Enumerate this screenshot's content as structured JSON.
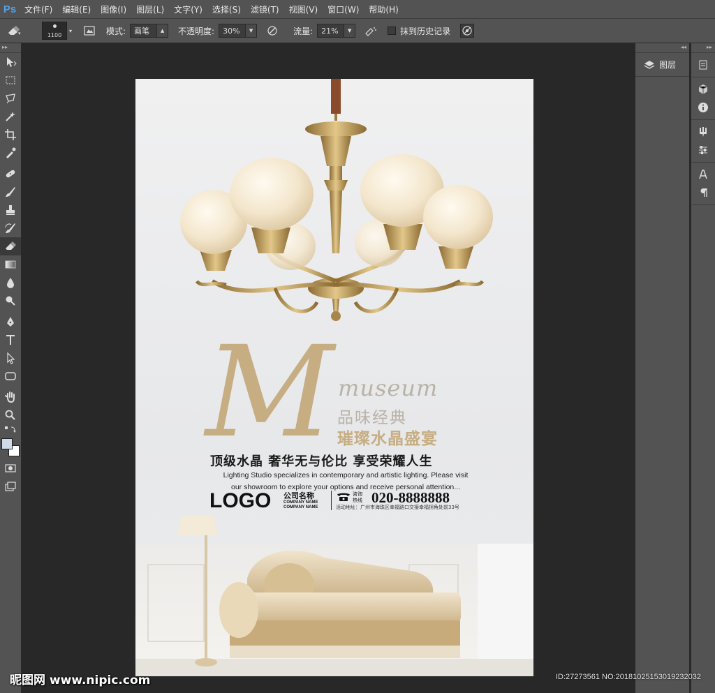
{
  "menubar": {
    "app_logo": "Ps",
    "items": [
      "文件(F)",
      "编辑(E)",
      "图像(I)",
      "图层(L)",
      "文字(Y)",
      "选择(S)",
      "滤镜(T)",
      "视图(V)",
      "窗口(W)",
      "帮助(H)"
    ]
  },
  "options": {
    "tool_icon": "eraser-icon",
    "brush_size": "1100",
    "mode_label": "模式:",
    "mode_value": "画笔",
    "opacity_label": "不透明度:",
    "opacity_value": "30%",
    "flow_label": "流量:",
    "flow_value": "21%",
    "erase_history_label": "抹到历史记录",
    "erase_history_checked": false
  },
  "panels": {
    "layers_label": "图层"
  },
  "poster": {
    "m_letter": "M",
    "museum": "museum",
    "subtitle1": "品味经典",
    "subtitle2": "璀璨水晶盛宴",
    "tagline": "顶级水晶 奢华无与伦比 享受荣耀人生",
    "english_line1": "Lighting Studio specializes in contemporary and artistic lighting. Please visit",
    "english_line2": "our showroom to explore your options and receive personal attention...",
    "logo": "LOGO",
    "company_name": "公司名称",
    "company_name_en1": "COMPANY NAME",
    "company_name_en2": "COMPANY NAME",
    "consult_line1": "咨询",
    "consult_line2": "热线",
    "phone": "020-8888888",
    "address": "活动地址：广州市海珠区幸福路口交接幸福拐角处前33号"
  },
  "watermark": {
    "left": "昵图网 www.nipic.com",
    "right": "ID:27273561 NO:20181025153019232032"
  },
  "colors": {
    "chrome": "#535353",
    "workspace": "#282828",
    "accent_gold": "#c6ad82",
    "ps_blue": "#4fa3e8"
  }
}
